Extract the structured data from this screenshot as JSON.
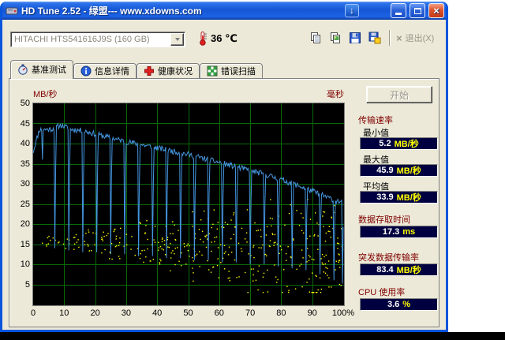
{
  "window": {
    "title": "HD Tune 2.52 - 绿盟--- www.xdowns.com"
  },
  "icons": {
    "download_glyph": "↓",
    "close_glyph": "×",
    "exit_glyph": "×",
    "titlebar": [
      "hard-disk-icon",
      "download-arrow-icon",
      "minimize-icon",
      "maximize-icon",
      "close-icon"
    ],
    "toolbar": [
      "thermometer-icon",
      "copy-text-icon",
      "copy-screenshot-icon",
      "save-icon",
      "save-screenshot-icon",
      "exit-x-icon"
    ],
    "tabs": [
      "benchmark-gauge-icon",
      "info-icon",
      "health-cross-icon",
      "error-scan-grid-icon"
    ],
    "dropdown": "chevron-down-icon"
  },
  "toolbar": {
    "drive": "HITACHI HTS541616J9S (160 GB)",
    "temperature": "36 ℃",
    "exit_label": "退出(X)"
  },
  "tabs": [
    {
      "label": "基准测试",
      "active": true
    },
    {
      "label": "信息详情",
      "active": false
    },
    {
      "label": "健康状况",
      "active": false
    },
    {
      "label": "错误扫描",
      "active": false
    }
  ],
  "results": {
    "start_button": "开始",
    "transfer_rate": {
      "title": "传输速率",
      "rows": [
        {
          "label": "最小值",
          "value": "5.2",
          "unit": "MB/秒"
        },
        {
          "label": "最大值",
          "value": "45.9",
          "unit": "MB/秒"
        },
        {
          "label": "平均值",
          "value": "33.9",
          "unit": "MB/秒"
        }
      ]
    },
    "access_time": {
      "title": "数据存取时间",
      "value": "17.3",
      "unit": "ms"
    },
    "burst_rate": {
      "title": "突发数据传输率",
      "value": "83.4",
      "unit": "MB/秒"
    },
    "cpu_usage": {
      "title": "CPU 使用率",
      "value": "3.6",
      "unit": "%"
    }
  },
  "colors": {
    "window_chrome": "#0855dd",
    "client_bg": "#ece9d8",
    "group_label": "#800000",
    "value_box_bg": "#000040",
    "value_number": "#ffffff",
    "value_unit": "#ffff00",
    "disabled_text": "#9a9589"
  },
  "chart_data": {
    "type": "line+scatter",
    "x_axis": {
      "min": 0,
      "max": 100,
      "ticks": [
        "0",
        "10",
        "20",
        "30",
        "40",
        "50",
        "60",
        "70",
        "80",
        "90",
        "100%"
      ]
    },
    "y_left": {
      "label": "MB/秒",
      "min": 0,
      "max": 50,
      "ticks": [
        50,
        45,
        40,
        35,
        30,
        25,
        20,
        15,
        10,
        5
      ]
    },
    "y_right": {
      "label": "毫秒"
    },
    "plot_bg": "#000000",
    "grid_color": "#0a6a0a",
    "transfer_line": {
      "name": "传输速率",
      "color": "#4596e0",
      "noise_seed": 11,
      "noise_amp": 1.4,
      "baseline": [
        [
          0,
          38
        ],
        [
          2,
          43.4
        ],
        [
          6,
          43.6
        ],
        [
          9,
          44.6
        ],
        [
          12,
          43.6
        ],
        [
          16,
          43.2
        ],
        [
          20,
          42.4
        ],
        [
          25,
          41.4
        ],
        [
          30,
          40.5
        ],
        [
          35,
          39.7
        ],
        [
          40,
          38.9
        ],
        [
          45,
          38.1
        ],
        [
          50,
          37.3
        ],
        [
          55,
          36.3
        ],
        [
          60,
          35.3
        ],
        [
          65,
          34.3
        ],
        [
          70,
          33.3
        ],
        [
          75,
          32.3
        ],
        [
          80,
          31
        ],
        [
          85,
          29.7
        ],
        [
          90,
          28.2
        ],
        [
          95,
          26.6
        ],
        [
          100,
          25.2
        ]
      ],
      "spikes": [
        {
          "x": 3,
          "low": 36
        },
        {
          "x": 7,
          "low": 14
        },
        {
          "x": 11.5,
          "low": 13.5
        },
        {
          "x": 16,
          "low": 13
        },
        {
          "x": 20.5,
          "low": 13
        },
        {
          "x": 25,
          "low": 12.5
        },
        {
          "x": 29.5,
          "low": 12.5
        },
        {
          "x": 34,
          "low": 12
        },
        {
          "x": 38.5,
          "low": 12
        },
        {
          "x": 43,
          "low": 11.5
        },
        {
          "x": 47.5,
          "low": 11.5
        },
        {
          "x": 52,
          "low": 11
        },
        {
          "x": 56.5,
          "low": 11
        },
        {
          "x": 61,
          "low": 10.5
        },
        {
          "x": 65.5,
          "low": 10.5
        },
        {
          "x": 70,
          "low": 10
        },
        {
          "x": 74.5,
          "low": 10
        },
        {
          "x": 79,
          "low": 9.5
        },
        {
          "x": 83.5,
          "low": 9
        },
        {
          "x": 88,
          "low": 8.5
        },
        {
          "x": 92.5,
          "low": 7.5
        },
        {
          "x": 97,
          "low": 6
        },
        {
          "x": 99.8,
          "low": 5.2
        }
      ]
    },
    "access_scatter": {
      "name": "存取时间",
      "color": "#ffff00",
      "seed": 29,
      "attempts": 650,
      "density": [
        0.18,
        0.82
      ],
      "center": [
        15.8,
        -0.025
      ],
      "spread": [
        1.1,
        0.165
      ],
      "y_min": 3,
      "y_max": 26.5
    },
    "summary": {
      "min_mb_s": 5.2,
      "max_mb_s": 45.9,
      "avg_mb_s": 33.9,
      "access_ms": 17.3,
      "burst_mb_s": 83.4,
      "cpu_pct": 3.6
    }
  }
}
